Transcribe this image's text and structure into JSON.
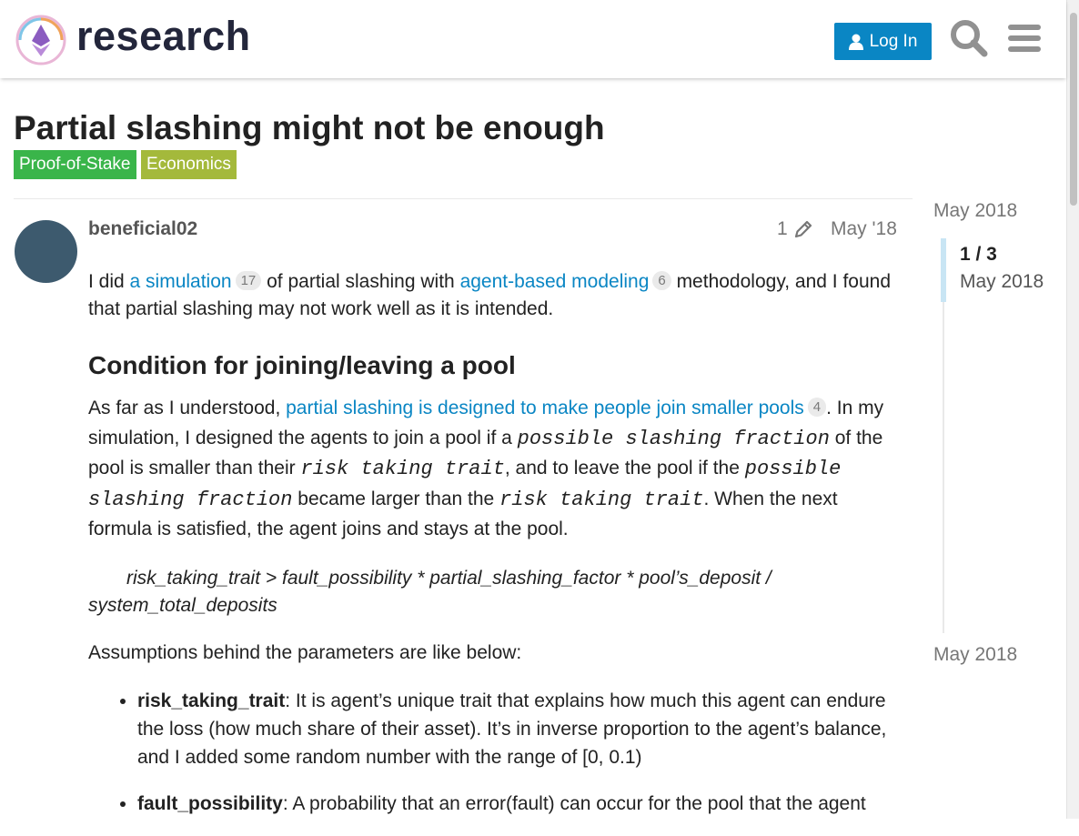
{
  "header": {
    "brand": "research",
    "login_label": "Log In"
  },
  "topic": {
    "title": "Partial slashing might not be enough",
    "tags": [
      {
        "label": "Proof-of-Stake",
        "color": "#3ab54a"
      },
      {
        "label": "Economics",
        "color": "#a4b93b"
      }
    ]
  },
  "post": {
    "username": "beneficial02",
    "edit_count": "1",
    "date": "May '18",
    "intro": {
      "t1": "I did ",
      "link1": "a simulation",
      "c1": "17",
      "t2": " of partial slashing with ",
      "link2": "agent-based modeling",
      "c2": "6",
      "t3": " methodology, and I found that partial slashing may not work well as it is intended."
    },
    "heading": "Condition for joining/leaving a pool",
    "para2": {
      "t1": "As far as I understood, ",
      "link": "partial slashing is designed to make people join smaller pools",
      "c": "4",
      "t2": ". In my simulation, I designed the agents to join a pool if a ",
      "code1": "possible slashing fraction",
      "t3": " of the pool is smaller than their ",
      "code2": "risk taking trait",
      "t4": ", and to leave the pool if the ",
      "code3": "possible slashing fraction",
      "t5": " became larger than the ",
      "code4": "risk taking trait",
      "t6": ". When the next formula is satisfied, the agent joins and stays at the pool."
    },
    "formula": "risk_taking_trait > fault_possibility * partial_slashing_factor * pool’s_deposit / system_total_deposits",
    "assumptions": "Assumptions behind the parameters are like below:",
    "bullets": [
      {
        "term": "risk_taking_trait",
        "text": ": It is agent’s unique trait that explains how much this agent can endure the loss (how much share of their asset). It’s in inverse proportion to the agent’s balance, and I added some random number with the range of [0, 0.1)"
      },
      {
        "term": "fault_possibility",
        "text": ": A probability that an error(fault) can occur for the pool that the agent"
      }
    ]
  },
  "timeline": {
    "top_date": "May 2018",
    "position": "1 / 3",
    "current_date": "May 2018",
    "bottom_date": "May 2018"
  }
}
